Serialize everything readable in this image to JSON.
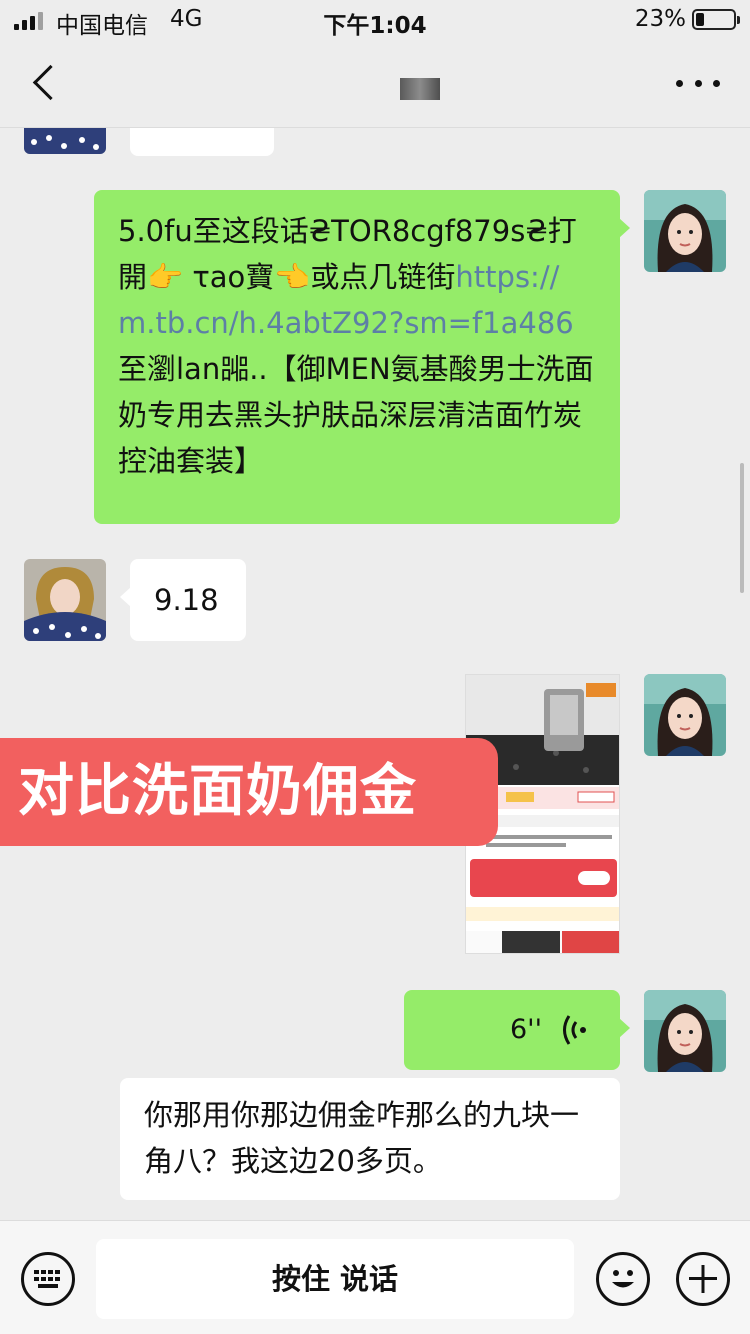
{
  "status_bar": {
    "carrier": "中国电信",
    "network": "4G",
    "time": "下午1:04",
    "battery_percent": "23%",
    "battery_level": 0.23
  },
  "nav": {
    "back_icon": "back-arrow-icon",
    "more_icon": "more-dots-icon"
  },
  "messages": {
    "m1": {
      "text_before_link": "5.0fu至这段话₴TOR8cgf879s₴打開👉 τao寶👈或点几链街",
      "link": "https://m.tb.cn/h.4abtZ92?sm=f1a486",
      "text_after_link": " 至瀏lan嘂..【御MEN氨基酸男士洗面奶专用去黑头护肤品深层清洁面竹炭控油套装】"
    },
    "m2": {
      "text": "9.18"
    },
    "overlay_caption": "对比洗面奶佣金",
    "m4": {
      "duration": "6''",
      "icon": "voice-wave-icon"
    },
    "m5": {
      "text": "你那用你那边佣金咋那么的九块一角八？我这边20多页。"
    }
  },
  "input_bar": {
    "voice_keyboard_icon": "keyboard-icon",
    "hold_to_talk": "按住 说话",
    "emoji_icon": "emoji-icon",
    "plus_icon": "plus-icon"
  },
  "colors": {
    "bubble_right": "#95ec69",
    "bubble_left": "#ffffff",
    "background": "#ededed",
    "overlay": "#f2605f",
    "link": "#5d7fa6"
  }
}
